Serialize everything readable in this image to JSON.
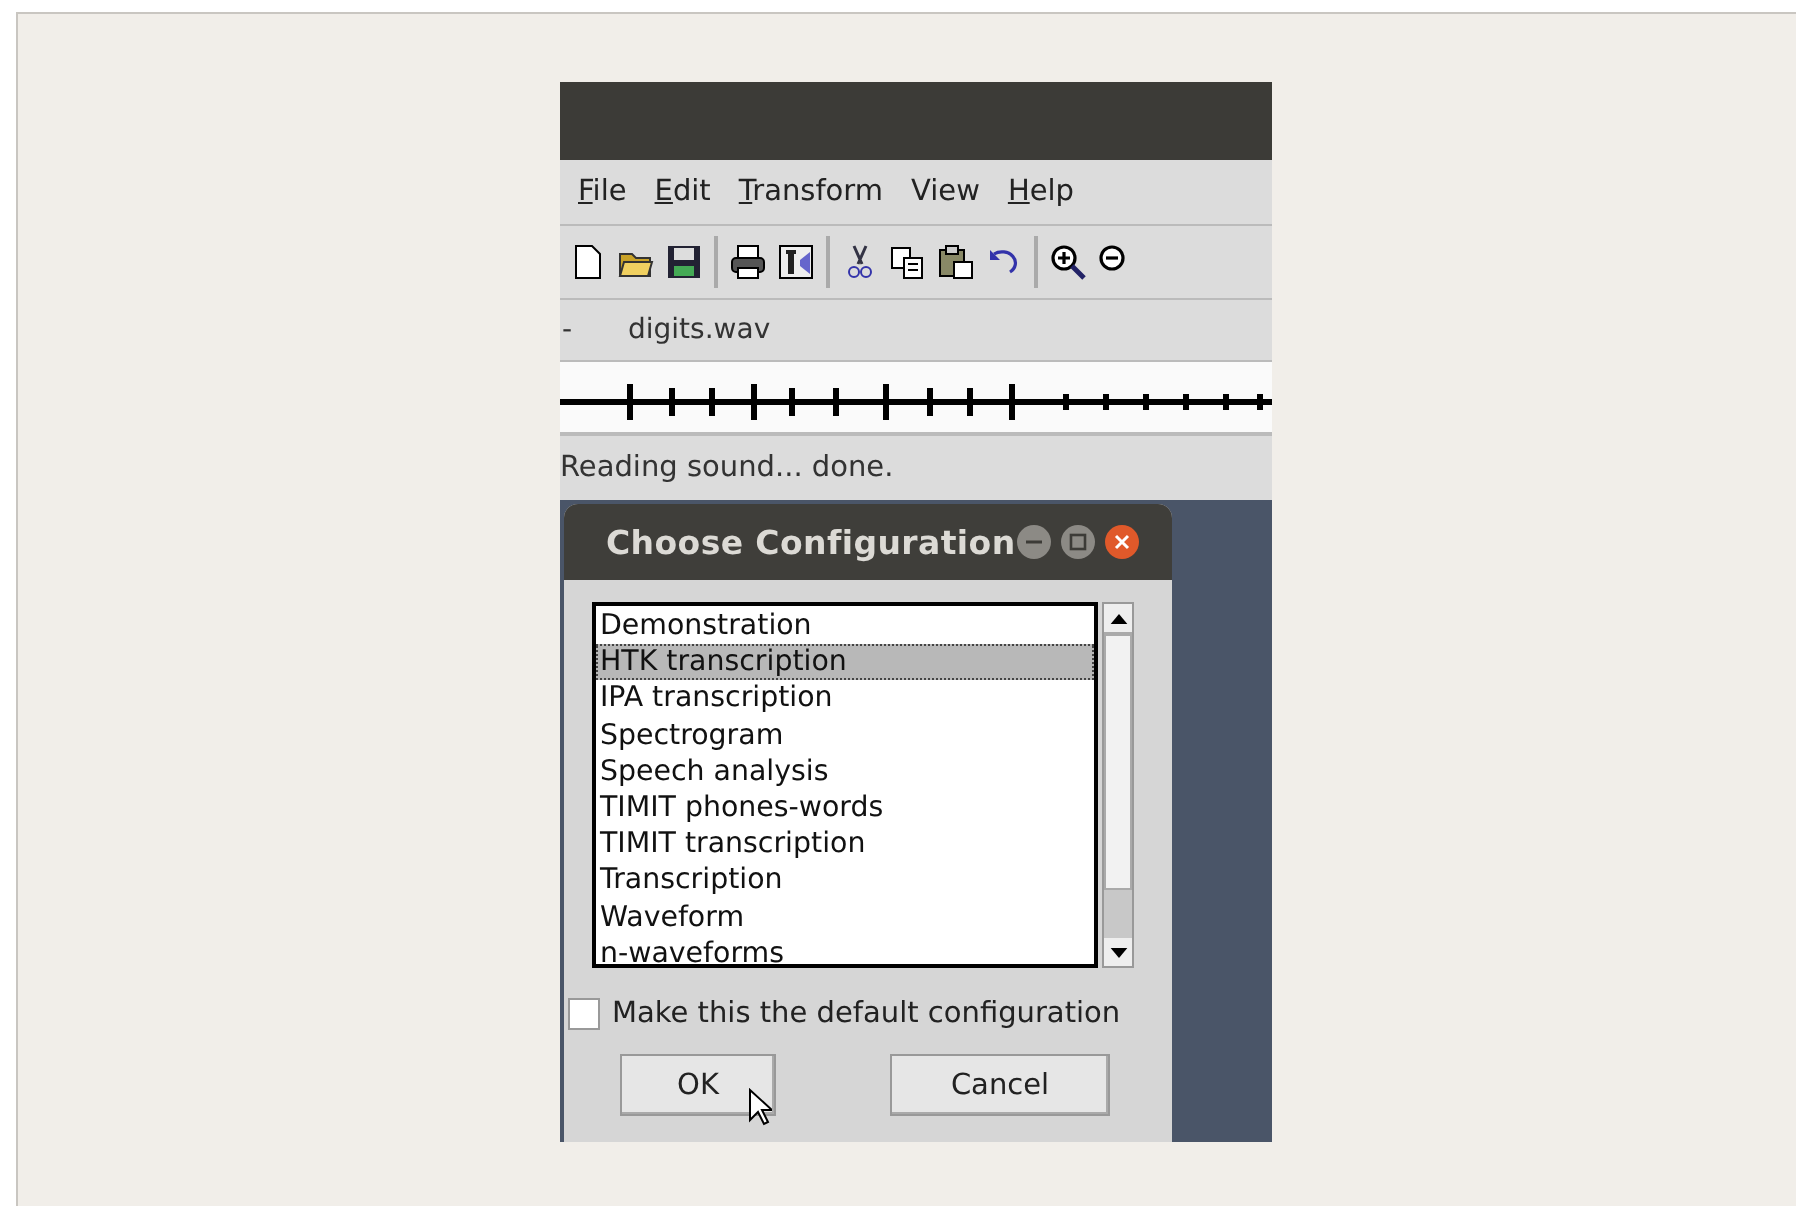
{
  "menu": [
    {
      "label": "File",
      "underlined_first": true
    },
    {
      "label": "Edit",
      "underlined_first": true
    },
    {
      "label": "Transform",
      "underlined_first": true
    },
    {
      "label": "View",
      "underlined_first": false
    },
    {
      "label": "Help",
      "underlined_first": true
    }
  ],
  "file_row": {
    "marker": "-",
    "filename": "digits.wav"
  },
  "status_bar": "Reading sound... done.",
  "dialog": {
    "title": "Choose Configuration",
    "items": [
      {
        "label": "Demonstration",
        "selected": false
      },
      {
        "label": "HTK transcription",
        "selected": true
      },
      {
        "label": "IPA transcription",
        "selected": false
      },
      {
        "label": "Spectrogram",
        "selected": false
      },
      {
        "label": "Speech analysis",
        "selected": false
      },
      {
        "label": "TIMIT phones-words",
        "selected": false
      },
      {
        "label": "TIMIT transcription",
        "selected": false
      },
      {
        "label": "Transcription",
        "selected": false
      },
      {
        "label": "Waveform",
        "selected": false
      },
      {
        "label": "n-waveforms",
        "selected": false
      }
    ],
    "default_checkbox": {
      "label": "Make this the default configuration",
      "checked": false
    },
    "buttons": [
      "OK",
      "Cancel"
    ]
  }
}
